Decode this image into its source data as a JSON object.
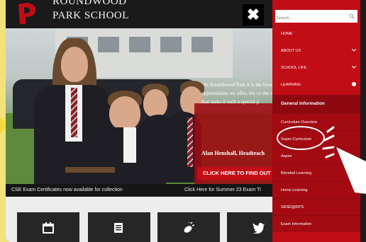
{
  "header": {
    "school_name_line1": "ROUNDWOOD",
    "school_name_line2": "PARK SCHOOL",
    "close_label": "✖"
  },
  "hero": {
    "quote": "\"At Roundwood Park it is the lives that excites us the most, opportunities we offer, the co the values we uphold, and th that make it such a special p",
    "author": "Alan Henshall, Headteach",
    "cta_label": "CLICK HERE TO FIND OUT M"
  },
  "ticker": {
    "left_text": "CSE Exam Certificates now available for collection",
    "right_text": "Click Here for Summer 23 Exam Ti"
  },
  "tiles": [
    {
      "icon": "calendar-icon"
    },
    {
      "icon": "document-icon"
    },
    {
      "icon": "rugby-ball-icon"
    },
    {
      "icon": "twitter-icon"
    }
  ],
  "menu": {
    "search_placeholder": "Search...",
    "items": [
      {
        "label": "HOME"
      },
      {
        "label": "ABOUT US"
      },
      {
        "label": "SCHOOL LIFE"
      },
      {
        "label": "LEARNING"
      },
      {
        "label": "General Information"
      },
      {
        "label": "Curriculum Overview"
      },
      {
        "label": "Super-Curriculum"
      },
      {
        "label": "Aspire"
      },
      {
        "label": "Blended Learning"
      },
      {
        "label": "Home Learning"
      },
      {
        "label": "SEND@RPS"
      },
      {
        "label": "Exam Information"
      }
    ]
  },
  "colors": {
    "brand_red": "#c00d16",
    "dark": "#1a1a1a",
    "highlight_yellow": "#f3d93c"
  }
}
